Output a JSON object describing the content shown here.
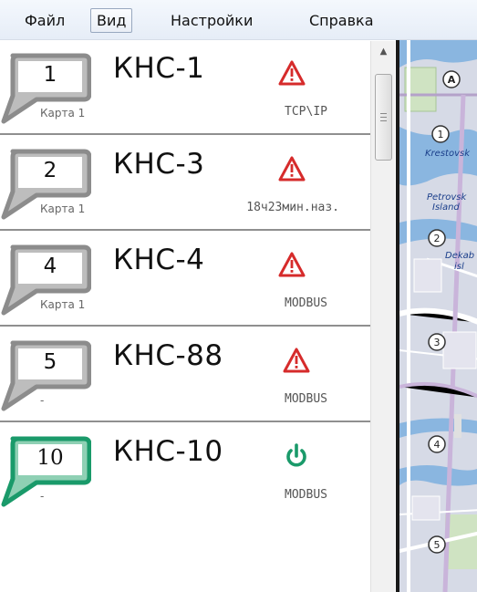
{
  "menu": {
    "items": [
      {
        "label": "Файл"
      },
      {
        "label": "Вид",
        "active": true
      },
      {
        "label": "Настройки"
      },
      {
        "label": "Справка"
      }
    ]
  },
  "stations": [
    {
      "number": "1",
      "name": "КНС-1",
      "map": "Карта 1",
      "info": "TCP\\IP",
      "status": "alarm-triangle-icon",
      "bubble_color": "#8c8c8c"
    },
    {
      "number": "2",
      "name": "КНС-3",
      "map": "Карта 1",
      "info": "18ч23мин.наз.",
      "status": "alarm-triangle-icon",
      "bubble_color": "#8c8c8c"
    },
    {
      "number": "4",
      "name": "КНС-4",
      "map": "Карта 1",
      "info": "MODBUS",
      "status": "alarm-triangle-icon",
      "bubble_color": "#8c8c8c"
    },
    {
      "number": "5",
      "name": "КНС-88",
      "map": "-",
      "info": "MODBUS",
      "status": "alarm-triangle-icon",
      "bubble_color": "#8c8c8c"
    },
    {
      "number": "10",
      "name": "КНС-10",
      "map": "-",
      "info": "MODBUS",
      "status": "power-icon",
      "bubble_color": "#1a9a6a"
    }
  ],
  "scrollbar": {
    "up_arrow": "▲"
  },
  "map": {
    "labels": [
      "Krestovsk",
      "Petrovsk",
      "Island",
      "Dekab",
      "isl"
    ],
    "markers": [
      "A",
      "1",
      "2",
      "3",
      "4",
      "5"
    ]
  },
  "colors": {
    "alarm": "#d62b2b",
    "power": "#1a9a6a",
    "bubble_gray": "#8c8c8c",
    "bubble_green": "#1a9a6a"
  }
}
